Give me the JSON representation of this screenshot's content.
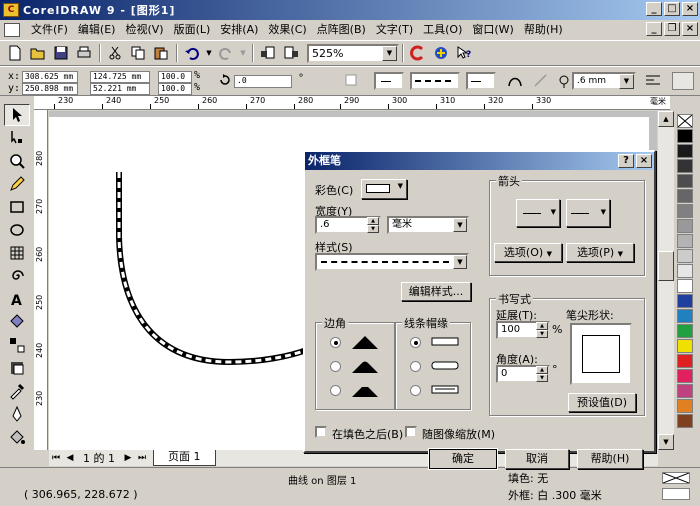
{
  "window": {
    "title": "CorelDRAW 9 - [图形1]"
  },
  "menu": {
    "items": [
      "文件(F)",
      "编辑(E)",
      "检视(V)",
      "版面(L)",
      "安排(A)",
      "效果(C)",
      "点阵图(B)",
      "文字(T)",
      "工具(O)",
      "窗口(W)",
      "帮助(H)"
    ]
  },
  "toolbar": {
    "zoom": "525%"
  },
  "propbar": {
    "x_label": "x:",
    "y_label": "y:",
    "x_value": "308.625 mm",
    "y_value": "250.898 mm",
    "w_value": "124.725 mm",
    "h_value": "52.221 mm",
    "sx_value": "100.0",
    "sy_value": "100.0",
    "pct": "%",
    "angle_value": ".0",
    "deg": "°",
    "outline_width": ".6 mm"
  },
  "ruler": {
    "h_labels": [
      "230",
      "240",
      "250",
      "260",
      "270",
      "280",
      "290",
      "300",
      "310",
      "320",
      "330",
      "毫米"
    ],
    "v_labels": [
      "280",
      "270",
      "260",
      "250",
      "240",
      "230"
    ]
  },
  "dialog": {
    "title": "外框笔",
    "color_label": "彩色(C)",
    "width_label": "宽度(Y)",
    "width_value": ".6",
    "unit_value": "毫米",
    "style_label": "样式(S)",
    "edit_style_btn": "编辑样式...",
    "corner_group": "边角",
    "line_caps_group": "线条帽缘",
    "arrows_group": "箭头",
    "options_btn_1": "选项(O)",
    "options_btn_2": "选项(P)",
    "calligraphy_group": "书写式",
    "stretch_label": "延展(T):",
    "stretch_value": "100",
    "stretch_unit": "%",
    "angle_label": "角度(A):",
    "angle_value": "0",
    "angle_unit": "°",
    "nib_shape_label": "笔尖形状:",
    "default_btn": "预设值(D)",
    "behind_fill_label": "在填色之后(B)",
    "scale_with_image_label": "随图像缩放(M)",
    "ok_btn": "确定",
    "cancel_btn": "取消",
    "help_btn": "帮助(H)"
  },
  "pagenav": {
    "page_count": "1 的 1",
    "page_tab": "页面 1"
  },
  "status": {
    "coords": "( 306.965, 228.672 )",
    "object": "曲线 on 图层 1",
    "fill": "填色: 无",
    "outline": "外框: 白  .300 毫米"
  },
  "palette": {
    "colors": [
      "#ffffff",
      "#000000",
      "#1a1a1a",
      "#333333",
      "#4d4d4d",
      "#666666",
      "#808080",
      "#999999",
      "#b3b3b3",
      "#cccccc",
      "#e6e6e6",
      "#ffffff",
      "#2040a0",
      "#2080c0",
      "#20a040",
      "#f0e000",
      "#e02020",
      "#e02060",
      "#c04080",
      "#e08020",
      "#804020"
    ]
  }
}
